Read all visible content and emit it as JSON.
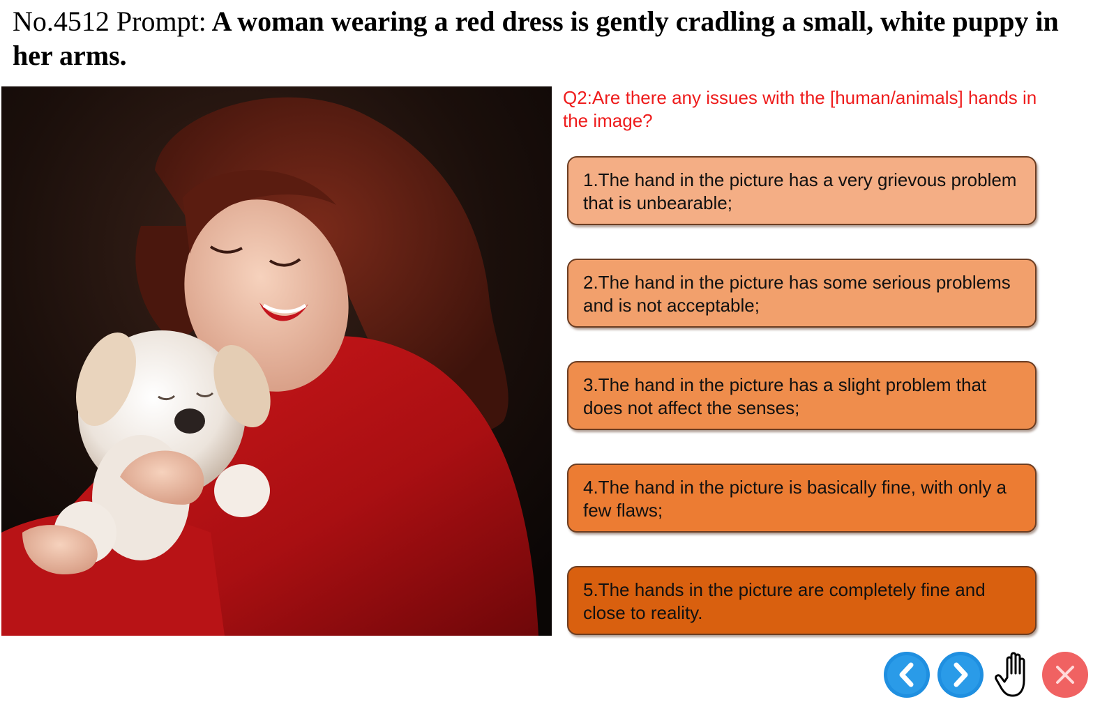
{
  "header": {
    "prefix": "No.4512 Prompt:",
    "prompt": "A woman wearing a red dress is gently cradling a small, white puppy in her arms."
  },
  "question": {
    "text": "Q2:Are there any issues with the [human/animals] hands in the image?",
    "color": "#ee1c1c"
  },
  "options": [
    {
      "label": "1.The hand in the picture has a very grievous problem that is unbearable;",
      "color": "#f4ae85"
    },
    {
      "label": "2.The hand in the picture has some serious problems and is not acceptable;",
      "color": "#f2a06c"
    },
    {
      "label": "3.The hand in the picture has a slight problem that does not affect the senses;",
      "color": "#ef8d4c"
    },
    {
      "label": "4.The hand in the picture is basically fine, with only a few flaws;",
      "color": "#ec7c33"
    },
    {
      "label": "5.The hands in the picture are completely fine and close to reality.",
      "color": "#d9600f"
    }
  ],
  "controls": [
    {
      "name": "previous-button",
      "icon": "chevron-left-icon",
      "color": "#1f8fe0"
    },
    {
      "name": "next-button",
      "icon": "chevron-right-icon",
      "color": "#1f8fe0"
    },
    {
      "name": "hand-tool-button",
      "icon": "hand-icon",
      "color": "#000000"
    },
    {
      "name": "close-button",
      "icon": "close-icon",
      "color": "#f06262"
    }
  ]
}
